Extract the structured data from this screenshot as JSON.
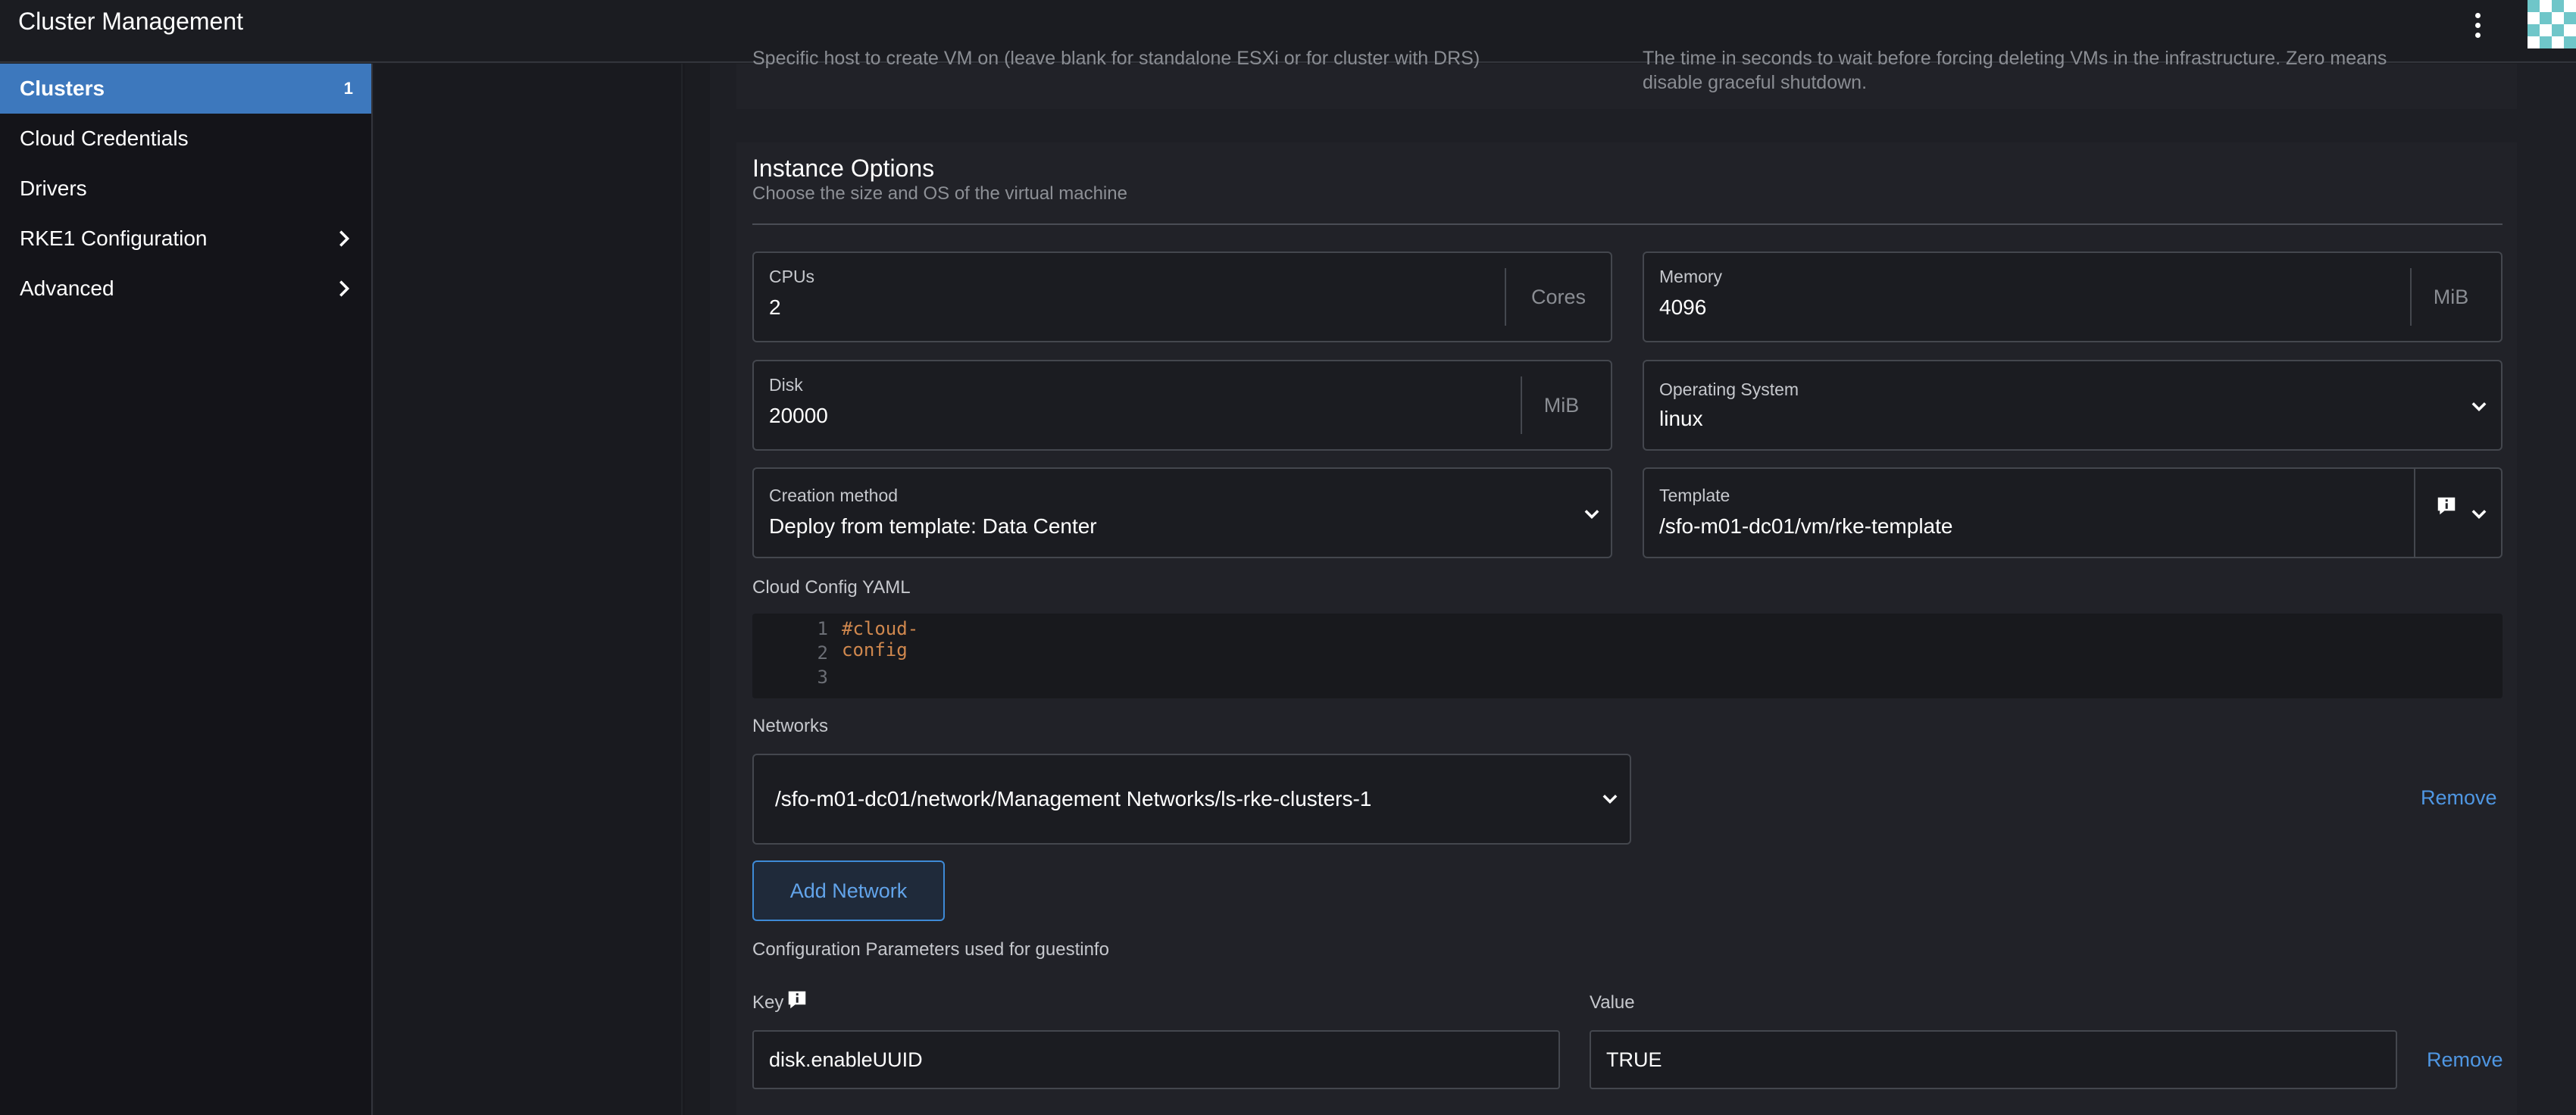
{
  "header": {
    "title": "Cluster Management"
  },
  "sidebar": {
    "items": [
      {
        "label": "Clusters",
        "badge": "1"
      },
      {
        "label": "Cloud Credentials"
      },
      {
        "label": "Drivers"
      },
      {
        "label": "RKE1 Configuration"
      },
      {
        "label": "Advanced"
      }
    ]
  },
  "above": {
    "left_help": "Specific host to create VM on (leave blank for standalone ESXi or for cluster with DRS)",
    "right_help_line1": "The time in seconds to wait before forcing deleting VMs in the infrastructure. Zero means",
    "right_help_line2": "disable graceful shutdown."
  },
  "instance_options": {
    "title": "Instance Options",
    "subtitle": "Choose the size and OS of the virtual machine",
    "cpus": {
      "label": "CPUs",
      "value": "2",
      "unit": "Cores"
    },
    "memory": {
      "label": "Memory",
      "value": "4096",
      "unit": "MiB"
    },
    "disk": {
      "label": "Disk",
      "value": "20000",
      "unit": "MiB"
    },
    "os": {
      "label": "Operating System",
      "value": "linux"
    },
    "creation": {
      "label": "Creation method",
      "value": "Deploy from template: Data Center"
    },
    "template": {
      "label": "Template",
      "value": "/sfo-m01-dc01/vm/rke-template"
    },
    "cloud_config": {
      "label": "Cloud Config YAML",
      "lines": [
        {
          "n": "1",
          "text": "#cloud-config"
        },
        {
          "n": "2",
          "text": ""
        },
        {
          "n": "3",
          "text": ""
        }
      ]
    },
    "networks": {
      "label": "Networks",
      "value": "/sfo-m01-dc01/network/Management Networks/ls-rke-clusters-1",
      "remove": "Remove",
      "add": "Add Network"
    },
    "guestinfo": {
      "label": "Configuration Parameters used for guestinfo",
      "key_label": "Key",
      "value_label": "Value",
      "key": "disk.enableUUID",
      "value": "TRUE",
      "remove": "Remove"
    }
  }
}
